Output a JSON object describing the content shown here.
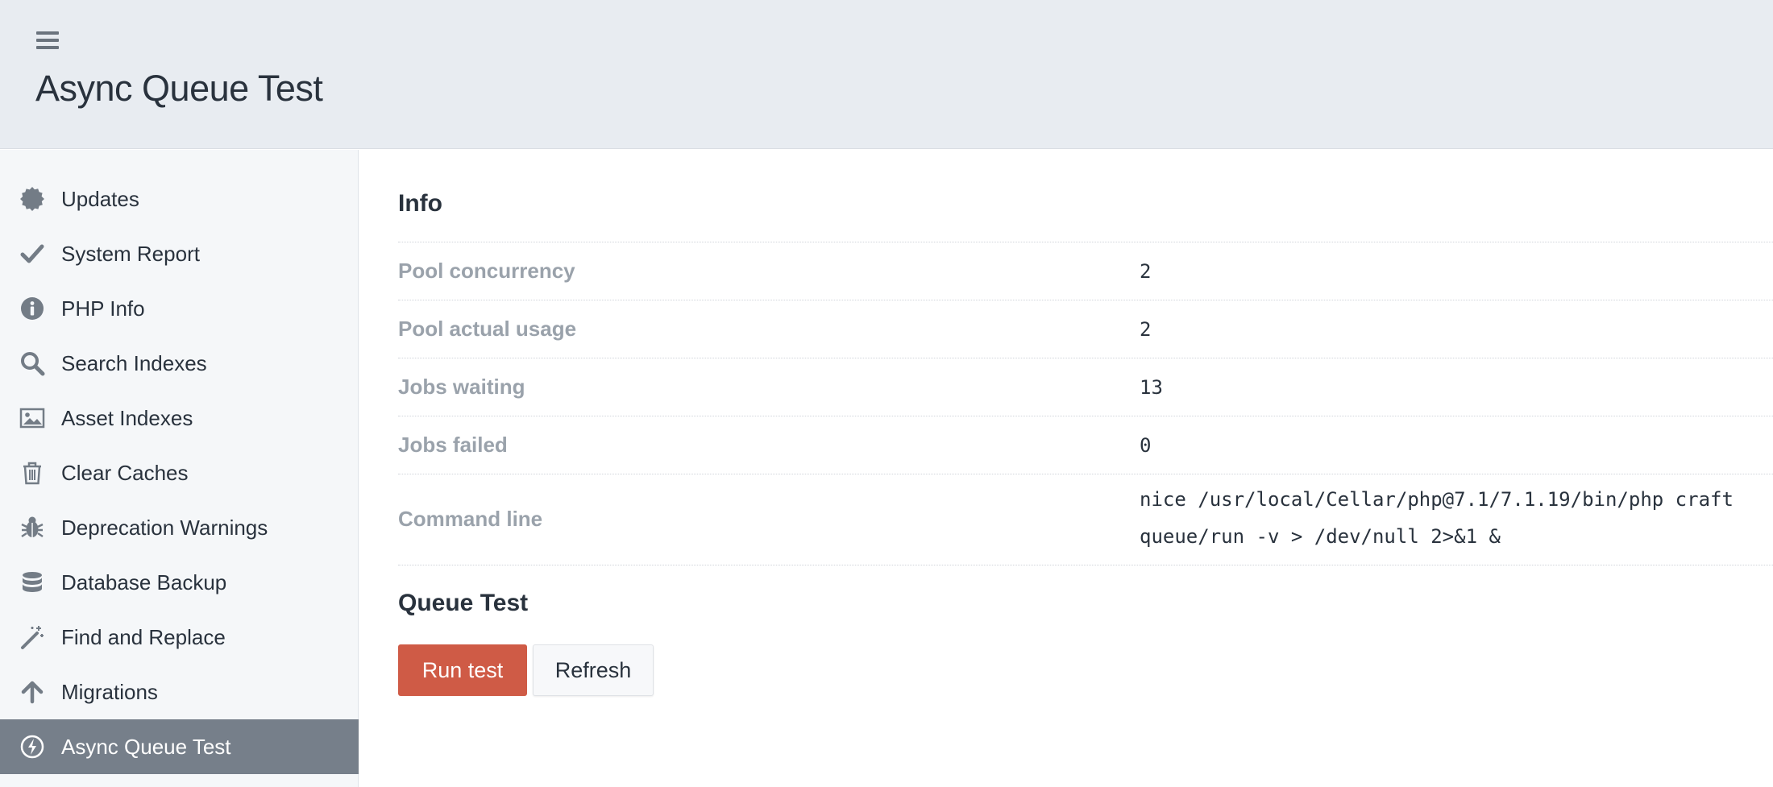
{
  "header": {
    "title": "Async Queue Test",
    "menu_icon": "hamburger-menu-icon"
  },
  "sidebar": {
    "items": [
      {
        "label": "Updates",
        "icon": "badge-icon",
        "active": false
      },
      {
        "label": "System Report",
        "icon": "checkmark-icon",
        "active": false
      },
      {
        "label": "PHP Info",
        "icon": "info-icon",
        "active": false
      },
      {
        "label": "Search Indexes",
        "icon": "search-icon",
        "active": false
      },
      {
        "label": "Asset Indexes",
        "icon": "image-icon",
        "active": false
      },
      {
        "label": "Clear Caches",
        "icon": "trash-icon",
        "active": false
      },
      {
        "label": "Deprecation Warnings",
        "icon": "bug-icon",
        "active": false
      },
      {
        "label": "Database Backup",
        "icon": "database-icon",
        "active": false
      },
      {
        "label": "Find and Replace",
        "icon": "magic-wand-icon",
        "active": false
      },
      {
        "label": "Migrations",
        "icon": "arrow-up-icon",
        "active": false
      },
      {
        "label": "Async Queue Test",
        "icon": "lightning-icon",
        "active": true
      }
    ]
  },
  "main": {
    "info_title": "Info",
    "rows": [
      {
        "key": "Pool concurrency",
        "value": "2"
      },
      {
        "key": "Pool actual usage",
        "value": "2"
      },
      {
        "key": "Jobs waiting",
        "value": "13"
      },
      {
        "key": "Jobs failed",
        "value": "0"
      },
      {
        "key": "Command line",
        "value": "nice /usr/local/Cellar/php@7.1/7.1.19/bin/php craft\nqueue/run -v > /dev/null 2>&1 &"
      }
    ],
    "queue_title": "Queue Test",
    "run_button": "Run test",
    "refresh_button": "Refresh"
  },
  "colors": {
    "header_bg": "#e8ecf1",
    "sidebar_bg": "#f5f7f9",
    "active_bg": "#767f8a",
    "run_button_bg": "#cf5b46",
    "label_gray": "#9aa2ab"
  }
}
